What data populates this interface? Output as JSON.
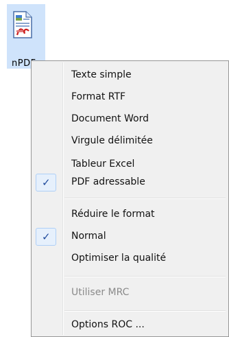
{
  "app": {
    "label": "nPDF",
    "icon": "pdf-document-icon"
  },
  "menu": {
    "items": [
      {
        "label": "Texte simple",
        "checked": false,
        "disabled": false
      },
      {
        "label": "Format RTF",
        "checked": false,
        "disabled": false
      },
      {
        "label": "Document Word",
        "checked": false,
        "disabled": false
      },
      {
        "label": "Virgule délimitée",
        "checked": false,
        "disabled": false
      },
      {
        "label": "Tableur Excel",
        "checked": false,
        "disabled": false
      },
      {
        "label": "PDF adressable",
        "checked": true,
        "disabled": false
      },
      {
        "label": "Réduire le format",
        "checked": false,
        "disabled": false
      },
      {
        "label": "Normal",
        "checked": true,
        "disabled": false
      },
      {
        "label": "Optimiser la qualité",
        "checked": false,
        "disabled": false
      },
      {
        "label": "Utiliser MRC",
        "checked": false,
        "disabled": true
      },
      {
        "label": "Options ROC ...",
        "checked": false,
        "disabled": false
      }
    ],
    "check_symbol": "✓"
  },
  "colors": {
    "tile_highlight": "#cfe3fb",
    "menu_background": "#f0f0f0",
    "check_color": "#1f4a9c",
    "disabled_text": "#8a8a8a"
  }
}
